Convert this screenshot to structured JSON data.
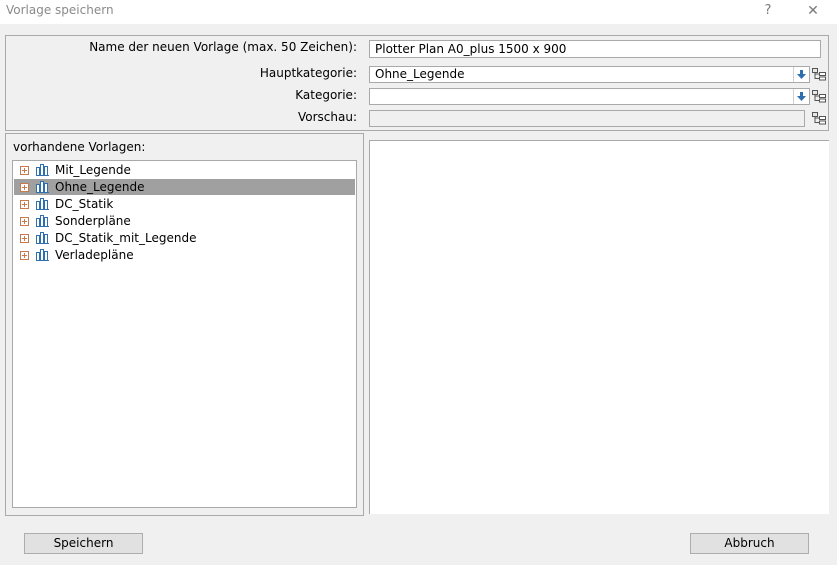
{
  "window": {
    "title": "Vorlage speichern",
    "help_glyph": "?",
    "close_glyph": "✕"
  },
  "form": {
    "name_label": "Name der neuen Vorlage (max. 50 Zeichen):",
    "name_value": "Plotter Plan A0_plus 1500 x 900",
    "hauptkategorie_label": "Hauptkategorie:",
    "hauptkategorie_value": "Ohne_Legende",
    "kategorie_label": "Kategorie:",
    "kategorie_value": "",
    "vorschau_label": "Vorschau:",
    "vorschau_value": ""
  },
  "templates": {
    "label": "vorhandene Vorlagen:",
    "items": [
      {
        "label": "Mit_Legende",
        "selected": false
      },
      {
        "label": "Ohne_Legende",
        "selected": true
      },
      {
        "label": "DC_Statik",
        "selected": false
      },
      {
        "label": "Sonderpläne",
        "selected": false
      },
      {
        "label": "DC_Statik_mit_Legende",
        "selected": false
      },
      {
        "label": "Verladepläne",
        "selected": false
      }
    ]
  },
  "buttons": {
    "save": "Speichern",
    "cancel": "Abbruch"
  },
  "icons": {
    "dropdown": "down-arrow-icon",
    "tree": "tree-structure-icon",
    "expand": "plus-box-icon",
    "folder": "template-group-icon"
  },
  "colors": {
    "selection": "#a0a0a0",
    "expander": "#c47a4e",
    "icon_blue": "#2f6fb0"
  }
}
